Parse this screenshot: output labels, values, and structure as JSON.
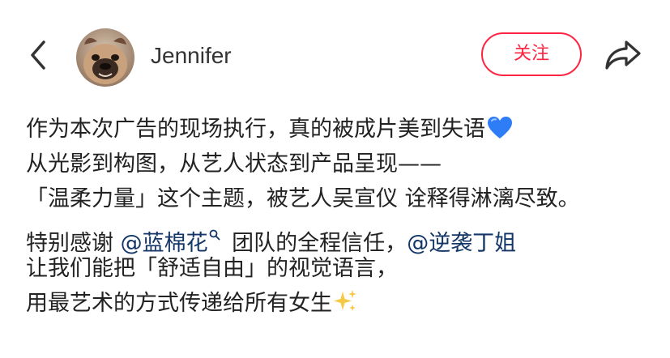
{
  "header": {
    "username": "Jennifer",
    "follow_label": "关注"
  },
  "icons": {
    "back": "chevron-left-icon",
    "share": "share-arrow-icon",
    "heart": "blue-heart-emoji",
    "sparkles": "sparkles-emoji",
    "search": "search-icon"
  },
  "colors": {
    "accent": "#ff2442",
    "mention": "#133667",
    "text": "#222222",
    "heart": "#2f7df6",
    "sparkle": "#f6c944"
  },
  "post": {
    "line1": "作为本次广告的现场执行，真的被成片美到失语",
    "line2": "从光影到构图，从艺人状态到产品呈现——",
    "line3": "「温柔力量」这个主题，被艺人吴宣仪 诠释得淋漓尽致。",
    "line4_prefix": "特别感谢 ",
    "mention1": "@蓝棉花",
    "line4_middle": " 团队的全程信任，",
    "mention2": "@逆袭丁姐",
    "line5": "让我们能把「舒适自由」的视觉语言，",
    "line6": "用最艺术的方式传递给所有女生"
  }
}
